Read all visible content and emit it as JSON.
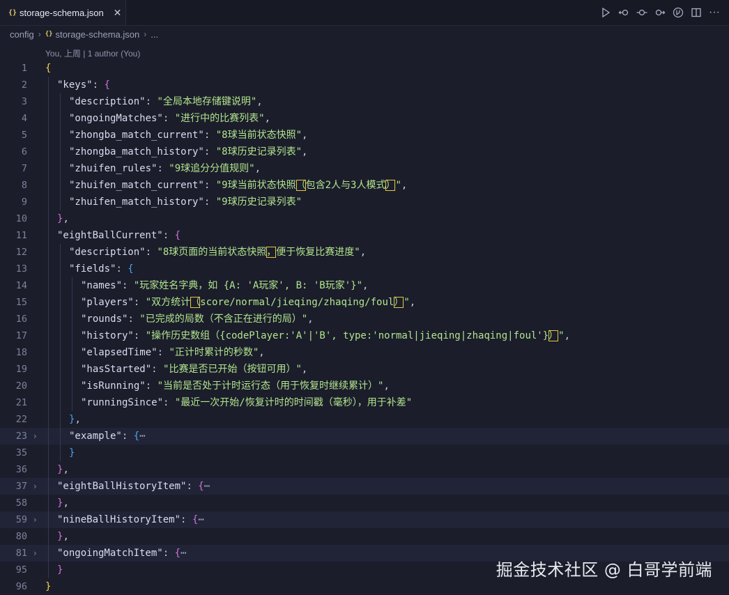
{
  "tab": {
    "title": "storage-schema.json",
    "icon": "json-file-icon"
  },
  "breadcrumb": {
    "folder": "config",
    "file": "storage-schema.json",
    "more": "..."
  },
  "blame": "You, 上周 | 1 author (You)",
  "watermark": "掘金技术社区 @ 白哥学前端",
  "colors": {
    "background": "#1b1d2b",
    "string": "#b2e58d",
    "key": "#d9dcef",
    "bracket_gold": "#f7d54a",
    "bracket_purple": "#cf72d8",
    "bracket_blue": "#47a3f3"
  },
  "lines": [
    {
      "n": "1",
      "i": 0,
      "parts": [
        [
          "b1",
          "{"
        ]
      ]
    },
    {
      "n": "2",
      "i": 1,
      "parts": [
        [
          "k",
          "\"keys\""
        ],
        [
          "p",
          ": "
        ],
        [
          "b2",
          "{"
        ]
      ]
    },
    {
      "n": "3",
      "i": 2,
      "parts": [
        [
          "k",
          "\"description\""
        ],
        [
          "p",
          ": "
        ],
        [
          "s",
          "\"全局本地存储键说明\""
        ],
        [
          "p",
          ","
        ]
      ]
    },
    {
      "n": "4",
      "i": 2,
      "parts": [
        [
          "k",
          "\"ongoingMatches\""
        ],
        [
          "p",
          ": "
        ],
        [
          "s",
          "\"进行中的比赛列表\""
        ],
        [
          "p",
          ","
        ]
      ]
    },
    {
      "n": "5",
      "i": 2,
      "parts": [
        [
          "k",
          "\"zhongba_match_current\""
        ],
        [
          "p",
          ": "
        ],
        [
          "s",
          "\"8球当前状态快照\""
        ],
        [
          "p",
          ","
        ]
      ]
    },
    {
      "n": "6",
      "i": 2,
      "parts": [
        [
          "k",
          "\"zhongba_match_history\""
        ],
        [
          "p",
          ": "
        ],
        [
          "s",
          "\"8球历史记录列表\""
        ],
        [
          "p",
          ","
        ]
      ]
    },
    {
      "n": "7",
      "i": 2,
      "parts": [
        [
          "k",
          "\"zhuifen_rules\""
        ],
        [
          "p",
          ": "
        ],
        [
          "s",
          "\"9球追分分值规则\""
        ],
        [
          "p",
          ","
        ]
      ]
    },
    {
      "n": "8",
      "i": 2,
      "parts": [
        [
          "k",
          "\"zhuifen_match_current\""
        ],
        [
          "p",
          ": "
        ],
        [
          "s",
          "\"9球当前状态快照"
        ],
        [
          "s boxed",
          "（"
        ],
        [
          "s",
          "包含2人与3人模式"
        ],
        [
          "s boxed",
          "）"
        ],
        [
          "s",
          "\""
        ],
        [
          "p",
          ","
        ]
      ]
    },
    {
      "n": "9",
      "i": 2,
      "parts": [
        [
          "k",
          "\"zhuifen_match_history\""
        ],
        [
          "p",
          ": "
        ],
        [
          "s",
          "\"9球历史记录列表\""
        ]
      ]
    },
    {
      "n": "10",
      "i": 1,
      "parts": [
        [
          "b2",
          "}"
        ],
        [
          "p",
          ","
        ]
      ]
    },
    {
      "n": "11",
      "i": 1,
      "parts": [
        [
          "k",
          "\"eightBallCurrent\""
        ],
        [
          "p",
          ": "
        ],
        [
          "b2",
          "{"
        ]
      ]
    },
    {
      "n": "12",
      "i": 2,
      "parts": [
        [
          "k",
          "\"description\""
        ],
        [
          "p",
          ": "
        ],
        [
          "s",
          "\"8球页面的当前状态快照"
        ],
        [
          "s boxed",
          "，"
        ],
        [
          "s",
          "便于恢复比赛进度\""
        ],
        [
          "p",
          ","
        ]
      ]
    },
    {
      "n": "13",
      "i": 2,
      "parts": [
        [
          "k",
          "\"fields\""
        ],
        [
          "p",
          ": "
        ],
        [
          "b3",
          "{"
        ]
      ]
    },
    {
      "n": "14",
      "i": 3,
      "parts": [
        [
          "k",
          "\"names\""
        ],
        [
          "p",
          ": "
        ],
        [
          "s",
          "\"玩家姓名字典，如 {A: 'A玩家', B: 'B玩家'}\""
        ],
        [
          "p",
          ","
        ]
      ]
    },
    {
      "n": "15",
      "i": 3,
      "parts": [
        [
          "k",
          "\"players\""
        ],
        [
          "p",
          ": "
        ],
        [
          "s",
          "\"双方统计"
        ],
        [
          "s boxed",
          "（"
        ],
        [
          "s",
          "score/normal/jieqing/zhaqing/foul"
        ],
        [
          "s boxed",
          "）"
        ],
        [
          "s",
          "\""
        ],
        [
          "p",
          ","
        ]
      ]
    },
    {
      "n": "16",
      "i": 3,
      "parts": [
        [
          "k",
          "\"rounds\""
        ],
        [
          "p",
          ": "
        ],
        [
          "s",
          "\"已完成的局数（不含正在进行的局）\""
        ],
        [
          "p",
          ","
        ]
      ]
    },
    {
      "n": "17",
      "i": 3,
      "parts": [
        [
          "k",
          "\"history\""
        ],
        [
          "p",
          ": "
        ],
        [
          "s",
          "\"操作历史数组（{codePlayer:'A'|'B', type:'normal|jieqing|zhaqing|foul'}"
        ],
        [
          "s boxed",
          "）"
        ],
        [
          "s",
          "\""
        ],
        [
          "p",
          ","
        ]
      ]
    },
    {
      "n": "18",
      "i": 3,
      "parts": [
        [
          "k",
          "\"elapsedTime\""
        ],
        [
          "p",
          ": "
        ],
        [
          "s",
          "\"正计时累计的秒数\""
        ],
        [
          "p",
          ","
        ]
      ]
    },
    {
      "n": "19",
      "i": 3,
      "parts": [
        [
          "k",
          "\"hasStarted\""
        ],
        [
          "p",
          ": "
        ],
        [
          "s",
          "\"比赛是否已开始（按钮可用）\""
        ],
        [
          "p",
          ","
        ]
      ]
    },
    {
      "n": "20",
      "i": 3,
      "parts": [
        [
          "k",
          "\"isRunning\""
        ],
        [
          "p",
          ": "
        ],
        [
          "s",
          "\"当前是否处于计时运行态（用于恢复时继续累计）\""
        ],
        [
          "p",
          ","
        ]
      ]
    },
    {
      "n": "21",
      "i": 3,
      "parts": [
        [
          "k",
          "\"runningSince\""
        ],
        [
          "p",
          ": "
        ],
        [
          "s",
          "\"最近一次开始/恢复计时的时间戳（毫秒），用于补差\""
        ]
      ]
    },
    {
      "n": "22",
      "i": 2,
      "parts": [
        [
          "b3",
          "}"
        ],
        [
          "p",
          ","
        ]
      ]
    },
    {
      "n": "23",
      "i": 2,
      "fold": true,
      "hl": true,
      "parts": [
        [
          "k",
          "\"example\""
        ],
        [
          "p",
          ": "
        ],
        [
          "b3",
          "{"
        ],
        [
          "dots",
          "⋯"
        ]
      ]
    },
    {
      "n": "35",
      "i": 2,
      "parts": [
        [
          "b3",
          "}"
        ]
      ]
    },
    {
      "n": "36",
      "i": 1,
      "parts": [
        [
          "b2",
          "}"
        ],
        [
          "p",
          ","
        ]
      ]
    },
    {
      "n": "37",
      "i": 1,
      "fold": true,
      "hl": true,
      "parts": [
        [
          "k",
          "\"eightBallHistoryItem\""
        ],
        [
          "p",
          ": "
        ],
        [
          "b2",
          "{"
        ],
        [
          "dots",
          "⋯"
        ]
      ]
    },
    {
      "n": "58",
      "i": 1,
      "parts": [
        [
          "b2",
          "}"
        ],
        [
          "p",
          ","
        ]
      ]
    },
    {
      "n": "59",
      "i": 1,
      "fold": true,
      "hl": true,
      "parts": [
        [
          "k",
          "\"nineBallHistoryItem\""
        ],
        [
          "p",
          ": "
        ],
        [
          "b2",
          "{"
        ],
        [
          "dots",
          "⋯"
        ]
      ]
    },
    {
      "n": "80",
      "i": 1,
      "parts": [
        [
          "b2",
          "}"
        ],
        [
          "p",
          ","
        ]
      ]
    },
    {
      "n": "81",
      "i": 1,
      "fold": true,
      "hl": true,
      "parts": [
        [
          "k",
          "\"ongoingMatchItem\""
        ],
        [
          "p",
          ": "
        ],
        [
          "b2",
          "{"
        ],
        [
          "dots",
          "⋯"
        ]
      ]
    },
    {
      "n": "95",
      "i": 1,
      "parts": [
        [
          "b2",
          "}"
        ]
      ]
    },
    {
      "n": "96",
      "i": 0,
      "parts": [
        [
          "b1",
          "}"
        ]
      ]
    }
  ]
}
